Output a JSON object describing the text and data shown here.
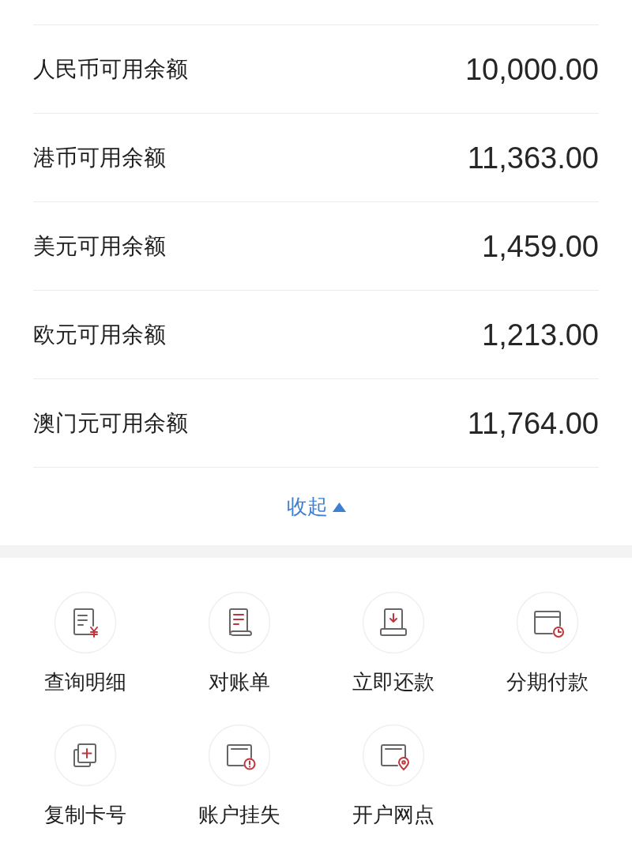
{
  "balances": [
    {
      "label": "人民币可用余额",
      "amount": "10,000.00"
    },
    {
      "label": "港币可用余额",
      "amount": "11,363.00"
    },
    {
      "label": "美元可用余额",
      "amount": "1,459.00"
    },
    {
      "label": "欧元可用余额",
      "amount": "1,213.00"
    },
    {
      "label": "澳门元可用余额",
      "amount": "11,764.00"
    }
  ],
  "collapse": {
    "label": "收起",
    "expanded": true
  },
  "actions": [
    {
      "label": "查询明细",
      "kind": "bill-yen"
    },
    {
      "label": "对账单",
      "kind": "scroll"
    },
    {
      "label": "立即还款",
      "kind": "tray-down"
    },
    {
      "label": "分期付款",
      "kind": "card-clock"
    },
    {
      "label": "复制卡号",
      "kind": "copy-plus"
    },
    {
      "label": "账户挂失",
      "kind": "card-alert"
    },
    {
      "label": "开户网点",
      "kind": "card-pin"
    }
  ]
}
